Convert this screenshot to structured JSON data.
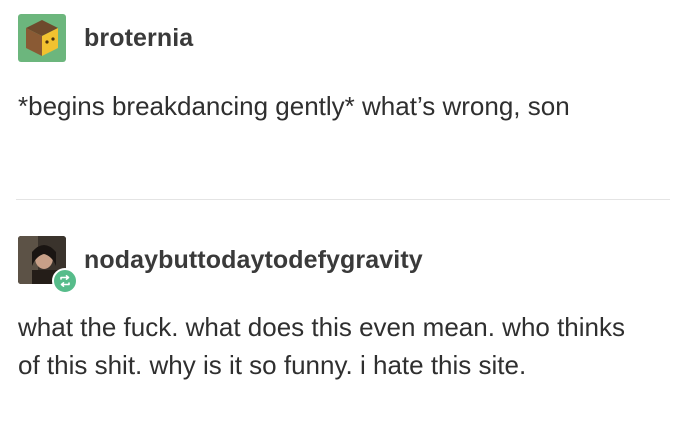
{
  "posts": [
    {
      "username": "broternia",
      "avatar_icon": "cube-icon",
      "text": "*begins breakdancing gently* what’s wrong, son"
    },
    {
      "username": "nodaybuttodaytodefygravity",
      "avatar_icon": "user-photo",
      "badge_icon": "reblog-icon",
      "text": "what the fuck. what does this even mean. who thinks of this shit. why is it so funny. i hate this site."
    }
  ],
  "colors": {
    "avatar_green": "#6cb67d",
    "reblog_green": "#56bc8a",
    "divider": "#e4e4e4"
  }
}
